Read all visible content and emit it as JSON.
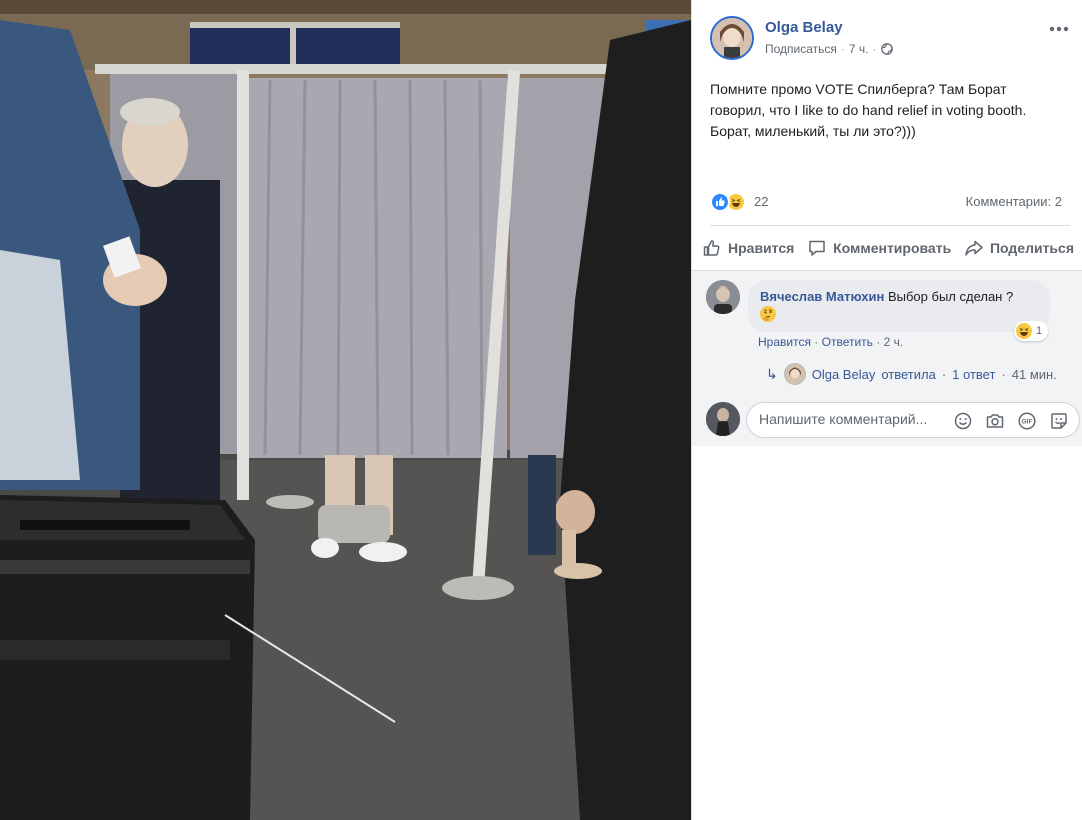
{
  "post": {
    "author": "Olga Belay",
    "subscribe_label": "Подписаться",
    "time": "7 ч.",
    "text_lines": [
      "Помните промо VOTE Спилберга? Там Борат",
      "говорил, что I like to do hand relief in voting booth.",
      "Борат, миленький, ты ли это?)))"
    ],
    "reaction_count": "22",
    "reaction_icons": [
      "like-icon",
      "haha-icon"
    ],
    "comments_label": "Комментарии: 2"
  },
  "actions": {
    "like": "Нравится",
    "comment": "Комментировать",
    "share": "Поделиться"
  },
  "comment": {
    "author": "Вячеслав Матюхин",
    "text": "Выбор был сделан ?",
    "reaction_count": "1",
    "like_link": "Нравится",
    "reply_link": "Ответить",
    "time": "2 ч."
  },
  "reply_summary": {
    "author": "Olga Belay",
    "verb": "ответила",
    "count": "1 ответ",
    "time": "41 мин."
  },
  "composer": {
    "placeholder": "Напишите комментарий..."
  },
  "colors": {
    "link": "#385898",
    "author": "#365899",
    "muted": "#606770",
    "like_blue": "#2d88ff",
    "haha_yellow": "#f7c843"
  }
}
